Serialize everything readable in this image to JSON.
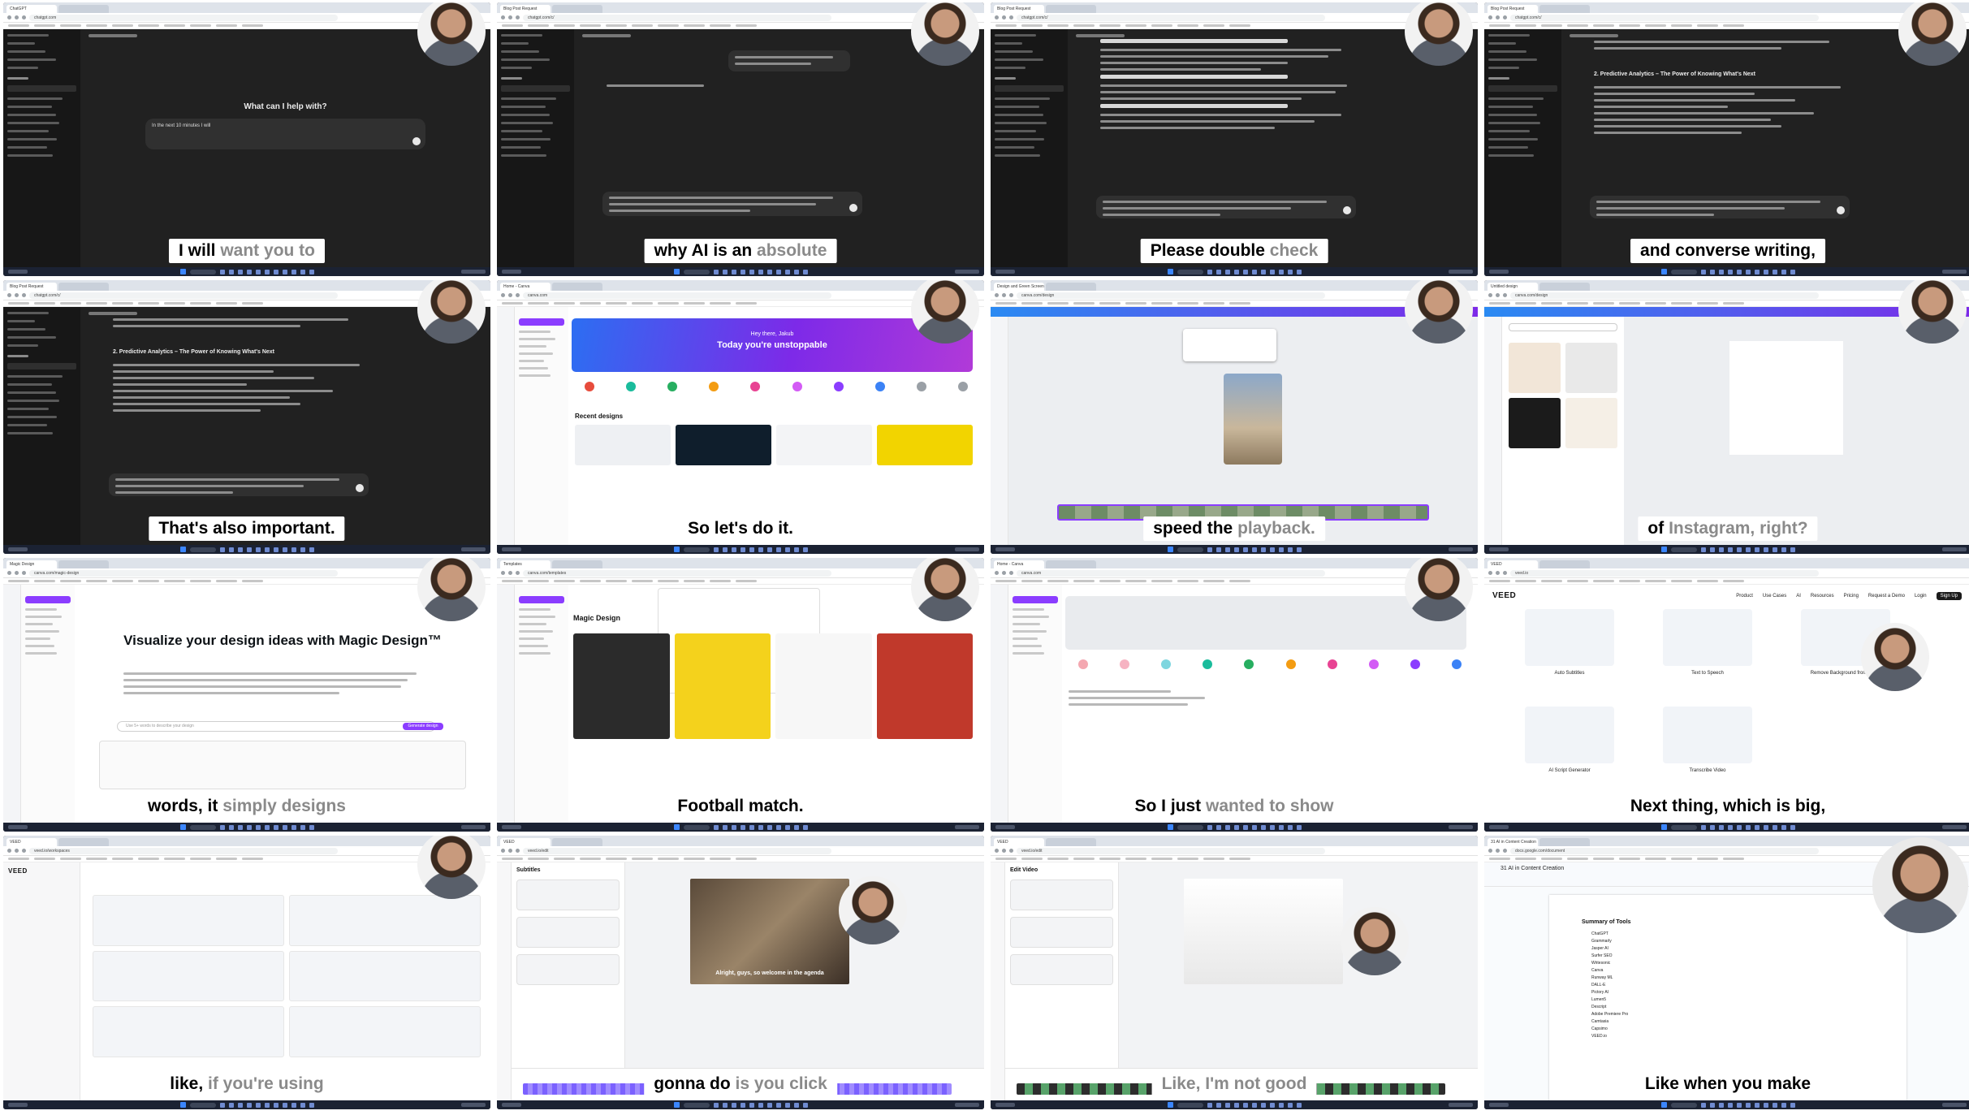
{
  "frames": [
    {
      "id": "f1",
      "app": "chatgpt-home",
      "url": "chatgpt.com",
      "tab": "ChatGPT",
      "heading": "What can I help with?",
      "prompt": "In the next 10 minutes I will",
      "subtitle_dark": "I will",
      "subtitle_gray": "want you to"
    },
    {
      "id": "f2",
      "app": "chatgpt-chat",
      "url": "chatgpt.com/c/",
      "tab": "Blog Post Request",
      "subtitle_dark": "why AI is an",
      "subtitle_gray": "absolute"
    },
    {
      "id": "f3",
      "app": "chatgpt-long",
      "url": "chatgpt.com/c/",
      "tab": "Blog Post Request",
      "subtitle_dark": "Please double",
      "subtitle_gray": "check"
    },
    {
      "id": "f4",
      "app": "chatgpt-long",
      "url": "chatgpt.com/c/",
      "tab": "Blog Post Request",
      "heading": "2. Predictive Analytics – The Power of Knowing What's Next",
      "subtitle_dark": "and converse writing,",
      "subtitle_gray": ""
    },
    {
      "id": "f5",
      "app": "chatgpt-long",
      "url": "chatgpt.com/c/",
      "tab": "Blog Post Request",
      "heading": "2. Predictive Analytics – The Power of Knowing What's Next",
      "subtitle_dark": "That's also important.",
      "subtitle_gray": ""
    },
    {
      "id": "f6",
      "app": "canva-home",
      "url": "canva.com",
      "tab": "Home - Canva",
      "banner_small": "Hey there, Jakub",
      "banner_big": "Today you're unstoppable",
      "section": "Recent designs",
      "subtitle_dark": "So let's do it.",
      "subtitle_gray": ""
    },
    {
      "id": "f7",
      "app": "canva-editor",
      "url": "canva.com/design",
      "tab": "Design and Green Screen",
      "subtitle_dark": "speed the",
      "subtitle_gray": "playback."
    },
    {
      "id": "f8",
      "app": "canva-templates",
      "url": "canva.com/design",
      "tab": "Untitled design",
      "subtitle_dark": "of",
      "subtitle_gray": "Instagram, right?"
    },
    {
      "id": "f9",
      "app": "canva-magic",
      "url": "canva.com/magic-design",
      "tab": "Magic Design",
      "heading": "Visualize your design ideas with Magic Design™",
      "search": "Use 5+ words to describe your design",
      "button": "Generate design",
      "subtitle_dark": "words, it",
      "subtitle_gray": "simply designs"
    },
    {
      "id": "f10",
      "app": "canva-results",
      "url": "canva.com/templates",
      "tab": "Templates",
      "section": "Magic Design",
      "subtitle_dark": "Football match.",
      "subtitle_gray": ""
    },
    {
      "id": "f11",
      "app": "canva-home2",
      "url": "canva.com",
      "tab": "Home - Canva",
      "subtitle_dark": "So I just",
      "subtitle_gray": "wanted to show"
    },
    {
      "id": "f12",
      "app": "veed-home",
      "url": "veed.io",
      "tab": "VEED",
      "logo": "VEED",
      "nav": [
        "Product",
        "Use Cases",
        "AI",
        "Resources",
        "Pricing",
        "Request a Demo",
        "Login",
        "Sign Up"
      ],
      "features": [
        "Auto Subtitles",
        "Text to Speech",
        "Remove Background from Video",
        "AI Script Generator",
        "Transcribe Video"
      ],
      "subtitle_dark": "Next thing, which is big,",
      "subtitle_gray": ""
    },
    {
      "id": "f13",
      "app": "veed-dashboard",
      "url": "veed.io/workspaces",
      "tab": "VEED",
      "logo": "VEED",
      "subtitle_dark": "like,",
      "subtitle_gray": "if you're using"
    },
    {
      "id": "f14",
      "app": "veed-editor",
      "url": "veed.io/edit",
      "tab": "VEED",
      "panel": "Subtitles",
      "caption": "Alright, guys, so welcome in the agenda",
      "subtitle_dark": "gonna do",
      "subtitle_gray": "is you click"
    },
    {
      "id": "f15",
      "app": "veed-editor2",
      "url": "veed.io/edit",
      "tab": "VEED",
      "panel": "Edit Video",
      "subtitle_dark": "",
      "subtitle_gray": "Like, I'm not good"
    },
    {
      "id": "f16",
      "app": "google-docs",
      "url": "docs.google.com/document",
      "tab": "31 AI in Content Creation",
      "title": "31 AI in Content Creation",
      "doc_heading": "Summary of Tools",
      "tools": [
        "ChatGPT",
        "Grammarly",
        "Jasper AI",
        "Surfer SEO",
        "Writesonic",
        "Canva",
        "Runway ML",
        "DALL-E",
        "Pictory AI",
        "Lumen5",
        "Descript",
        "Adobe Premiere Pro",
        "Camtasia",
        "Capsimo",
        "VEED.io"
      ],
      "subtitle_dark": "Like when you make",
      "subtitle_gray": ""
    }
  ]
}
